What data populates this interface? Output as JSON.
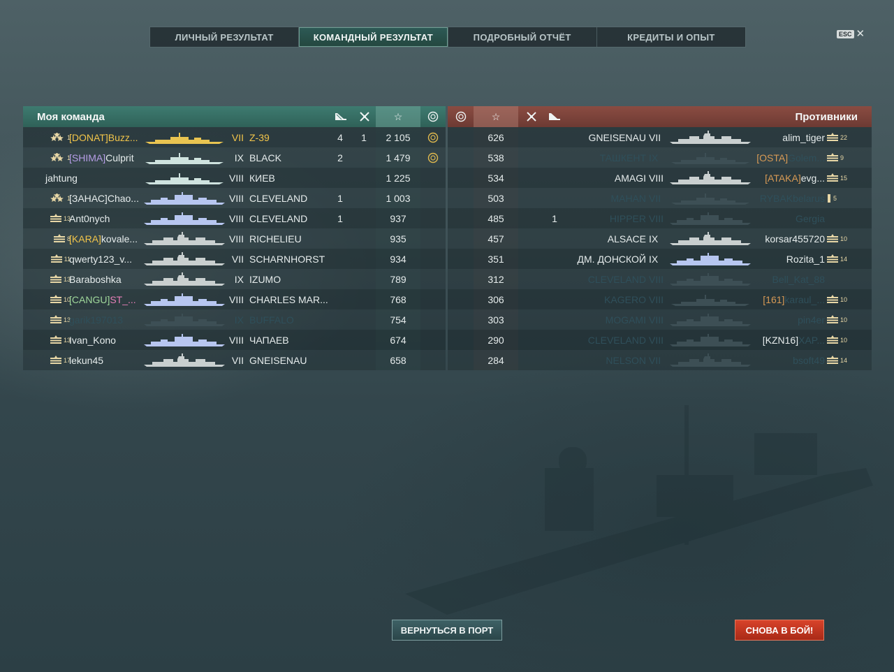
{
  "tabs": [
    {
      "label": "ЛИЧНЫЙ РЕЗУЛЬТАТ",
      "active": false
    },
    {
      "label": "КОМАНДНЫЙ РЕЗУЛЬТАТ",
      "active": true
    },
    {
      "label": "ПОДРОБНЫЙ ОТЧЁТ",
      "active": false
    },
    {
      "label": "КРЕДИТЫ И ОПЫТ",
      "active": false
    }
  ],
  "esc": {
    "key": "ESC",
    "close": "✕"
  },
  "my_team": {
    "title": "Моя команда",
    "columns": [
      "ship-kills-icon",
      "plane-kills-icon",
      "star-icon",
      "capture-icon"
    ],
    "rows": [
      {
        "rank_icon": "stars-rank-icon",
        "rank": "1",
        "clan": "[DONAT]",
        "clan_color": "yellow",
        "name": "Buzz...",
        "name_style": "gold",
        "tier": "VII",
        "ship": "Z-39",
        "ship_style": "gold",
        "kills": "4",
        "planes": "1",
        "xp": "2 105",
        "cap": true,
        "silhouette": "destroyer",
        "sil_color": "#e9c451"
      },
      {
        "rank_icon": "stars-rank-icon",
        "rank": "1",
        "clan": "[SHIMA]",
        "clan_color": "purple",
        "name": "Culprit",
        "name_style": "",
        "tier": "IX",
        "ship": "BLACK",
        "ship_style": "",
        "kills": "2",
        "planes": "",
        "xp": "1 479",
        "cap": true,
        "silhouette": "destroyer",
        "sil_color": "#cfe3df"
      },
      {
        "rank_icon": "",
        "rank": "",
        "clan": "",
        "clan_color": "",
        "name": "jahtung",
        "name_style": "",
        "tier": "VIII",
        "ship": "КИЕВ",
        "ship_style": "",
        "kills": "",
        "planes": "",
        "xp": "1 225",
        "cap": false,
        "silhouette": "destroyer",
        "sil_color": "#cfe3df"
      },
      {
        "rank_icon": "stars-rank-icon",
        "rank": "1",
        "clan": "[ЗАНАС]",
        "clan_color": "plain",
        "name": "Chao...",
        "name_style": "",
        "tier": "VIII",
        "ship": "CLEVELAND",
        "ship_style": "",
        "kills": "1",
        "planes": "",
        "xp": "1 003",
        "cap": false,
        "silhouette": "cruiser",
        "sil_color": "#b7c6f0"
      },
      {
        "rank_icon": "bars-rank-icon",
        "rank": "13",
        "clan": "",
        "clan_color": "",
        "name": "Ant0nych",
        "name_style": "",
        "tier": "VIII",
        "ship": "CLEVELAND",
        "ship_style": "",
        "kills": "1",
        "planes": "",
        "xp": "937",
        "cap": false,
        "silhouette": "cruiser",
        "sil_color": "#b7c6f0"
      },
      {
        "rank_icon": "bars-rank-icon",
        "rank": "8",
        "clan": "[KARA]",
        "clan_color": "yellow",
        "name": "kovale...",
        "name_style": "",
        "tier": "VIII",
        "ship": "RICHELIEU",
        "ship_style": "",
        "kills": "",
        "planes": "",
        "xp": "935",
        "cap": false,
        "silhouette": "battleship",
        "sil_color": "#c9cfcf"
      },
      {
        "rank_icon": "bars-rank-icon",
        "rank": "11",
        "clan": "",
        "clan_color": "",
        "name": "qwerty123_v...",
        "name_style": "",
        "tier": "VII",
        "ship": "SCHARNHORST",
        "ship_style": "",
        "kills": "",
        "planes": "",
        "xp": "934",
        "cap": false,
        "silhouette": "battleship",
        "sil_color": "#c9cfcf"
      },
      {
        "rank_icon": "bars-rank-icon",
        "rank": "13",
        "clan": "",
        "clan_color": "",
        "name": "Baraboshka",
        "name_style": "",
        "tier": "IX",
        "ship": "IZUMO",
        "ship_style": "",
        "kills": "",
        "planes": "",
        "xp": "789",
        "cap": false,
        "silhouette": "battleship",
        "sil_color": "#c9cfcf"
      },
      {
        "rank_icon": "bars-rank-icon",
        "rank": "10",
        "clan": "[CANGU]",
        "clan_color": "green",
        "name": "ST_...",
        "name_style": "pink",
        "tier": "VIII",
        "ship": "CHARLES MAR...",
        "ship_style": "",
        "kills": "",
        "planes": "",
        "xp": "768",
        "cap": false,
        "silhouette": "cruiser",
        "sil_color": "#b7c6f0"
      },
      {
        "rank_icon": "bars-rank-icon",
        "rank": "13",
        "clan": "",
        "clan_color": "",
        "name": "garik197013",
        "name_style": "dim",
        "tier": "IX",
        "ship": "BUFFALO",
        "ship_style": "dim",
        "kills": "",
        "planes": "",
        "xp": "754",
        "cap": false,
        "silhouette": "cruiser",
        "sil_color": "#3d4f55"
      },
      {
        "rank_icon": "bars-rank-icon",
        "rank": "13",
        "clan": "",
        "clan_color": "",
        "name": "Ivan_Kono",
        "name_style": "",
        "tier": "VIII",
        "ship": "ЧАПАЕВ",
        "ship_style": "",
        "kills": "",
        "planes": "",
        "xp": "674",
        "cap": false,
        "silhouette": "cruiser",
        "sil_color": "#b7c6f0"
      },
      {
        "rank_icon": "bars-rank-icon",
        "rank": "17",
        "clan": "",
        "clan_color": "",
        "name": "lekun45",
        "name_style": "",
        "tier": "VII",
        "ship": "GNEISENAU",
        "ship_style": "",
        "kills": "",
        "planes": "",
        "xp": "658",
        "cap": false,
        "silhouette": "battleship",
        "sil_color": "#c9cfcf"
      }
    ]
  },
  "enemy_team": {
    "title": "Противники",
    "columns": [
      "capture-icon",
      "star-icon",
      "plane-kills-icon",
      "ship-kills-icon"
    ],
    "rows": [
      {
        "xp": "626",
        "planes": "",
        "ship": "GNEISENAU",
        "tier": "VII",
        "ship_style": "",
        "clan": "",
        "clan_color": "",
        "name": "alim_tiger",
        "name_style": "",
        "rank": "22",
        "rank_icon": "bars-rank-icon",
        "silhouette": "battleship",
        "sil_color": "#c9cfcf"
      },
      {
        "xp": "538",
        "planes": "",
        "ship": "ТАШКЕНТ",
        "tier": "IX",
        "ship_style": "dim",
        "clan": "[OSTA]",
        "clan_color": "orange",
        "name": "Golem...",
        "name_style": "dim",
        "rank": "9",
        "rank_icon": "bars-rank-icon",
        "silhouette": "destroyer",
        "sil_color": "#3d4f55"
      },
      {
        "xp": "534",
        "planes": "",
        "ship": "AMAGI",
        "tier": "VIII",
        "ship_style": "",
        "clan": "[ATAKA]",
        "clan_color": "orange",
        "name": "evg...",
        "name_style": "",
        "rank": "15",
        "rank_icon": "bars-rank-icon",
        "silhouette": "battleship",
        "sil_color": "#c9cfcf"
      },
      {
        "xp": "503",
        "planes": "",
        "ship": "MAHAN",
        "tier": "VII",
        "ship_style": "dim",
        "clan": "",
        "clan_color": "",
        "name": "RYBAKbelarus",
        "name_style": "dim",
        "rank": "5",
        "rank_icon": "bar-rank-icon",
        "silhouette": "destroyer",
        "sil_color": "#3d4f55"
      },
      {
        "xp": "485",
        "planes": "1",
        "ship": "HIPPER",
        "tier": "VIII",
        "ship_style": "dim",
        "clan": "",
        "clan_color": "",
        "name": "Gergia",
        "name_style": "dim",
        "rank": "",
        "rank_icon": "",
        "silhouette": "cruiser",
        "sil_color": "#3d4f55"
      },
      {
        "xp": "457",
        "planes": "",
        "ship": "ALSACE",
        "tier": "IX",
        "ship_style": "",
        "clan": "",
        "clan_color": "",
        "name": "korsar455720",
        "name_style": "",
        "rank": "10",
        "rank_icon": "bars-rank-icon",
        "silhouette": "battleship",
        "sil_color": "#c9cfcf"
      },
      {
        "xp": "351",
        "planes": "",
        "ship": "ДМ. ДОНСКОЙ",
        "tier": "IX",
        "ship_style": "",
        "clan": "",
        "clan_color": "",
        "name": "Rozita_1",
        "name_style": "",
        "rank": "14",
        "rank_icon": "bars-rank-icon",
        "silhouette": "cruiser",
        "sil_color": "#b7c6f0"
      },
      {
        "xp": "312",
        "planes": "",
        "ship": "CLEVELAND",
        "tier": "VIII",
        "ship_style": "dim",
        "clan": "",
        "clan_color": "",
        "name": "Bell_Kat_88",
        "name_style": "dim",
        "rank": "",
        "rank_icon": "",
        "silhouette": "cruiser",
        "sil_color": "#3d4f55"
      },
      {
        "xp": "306",
        "planes": "",
        "ship": "KAGERO",
        "tier": "VIII",
        "ship_style": "dim",
        "clan": "[161]",
        "clan_color": "orange",
        "name": "karaul_...",
        "name_style": "dim",
        "rank": "10",
        "rank_icon": "bars-rank-icon",
        "silhouette": "destroyer",
        "sil_color": "#3d4f55"
      },
      {
        "xp": "303",
        "planes": "",
        "ship": "MOGAMI",
        "tier": "VIII",
        "ship_style": "dim",
        "clan": "",
        "clan_color": "",
        "name": "pin4er",
        "name_style": "dim",
        "rank": "10",
        "rank_icon": "bars-rank-icon",
        "silhouette": "cruiser",
        "sil_color": "#3d4f55"
      },
      {
        "xp": "290",
        "planes": "",
        "ship": "CLEVELAND",
        "tier": "VIII",
        "ship_style": "dim",
        "clan": "[KZN16]",
        "clan_color": "plain",
        "name": "XAP...",
        "name_style": "dim",
        "rank": "10",
        "rank_icon": "bars-rank-icon",
        "silhouette": "cruiser",
        "sil_color": "#3d4f55"
      },
      {
        "xp": "284",
        "planes": "",
        "ship": "NELSON",
        "tier": "VII",
        "ship_style": "dim",
        "clan": "",
        "clan_color": "",
        "name": "bsoft49",
        "name_style": "dim",
        "rank": "14",
        "rank_icon": "bars-rank-icon",
        "silhouette": "battleship",
        "sil_color": "#3d4f55"
      }
    ]
  },
  "buttons": {
    "port": "ВЕРНУТЬСЯ В ПОРТ",
    "battle": "СНОВА В БОЙ!"
  },
  "colors": {
    "my_team": "#3e7b70",
    "enemy": "#8a4c42",
    "gold": "#f2c54a",
    "battle_button": "#c8361f"
  }
}
